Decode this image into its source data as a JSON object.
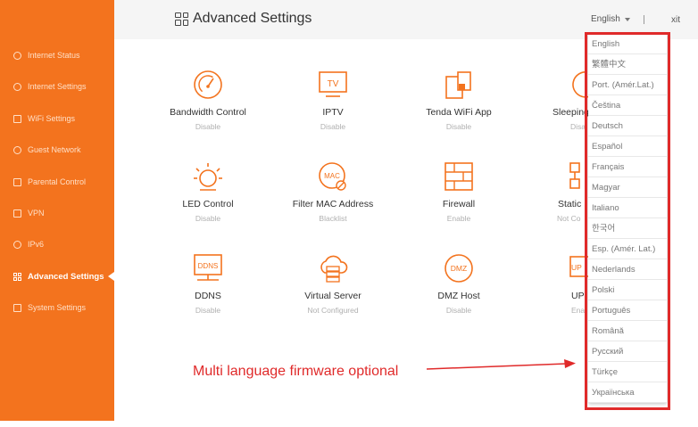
{
  "header": {
    "title": "Advanced Settings",
    "language": "English",
    "exit": "xit"
  },
  "sidebar": {
    "items": [
      {
        "label": "Internet Status",
        "icon": "globe-icon"
      },
      {
        "label": "Internet Settings",
        "icon": "internet-icon"
      },
      {
        "label": "WiFi Settings",
        "icon": "wifi-icon"
      },
      {
        "label": "Guest Network",
        "icon": "guest-icon"
      },
      {
        "label": "Parental Control",
        "icon": "parental-icon"
      },
      {
        "label": "VPN",
        "icon": "vpn-icon"
      },
      {
        "label": "IPv6",
        "icon": "ipv6-icon"
      },
      {
        "label": "Advanced Settings",
        "icon": "grid-icon",
        "active": true
      },
      {
        "label": "System Settings",
        "icon": "system-icon"
      }
    ]
  },
  "features": [
    {
      "label": "Bandwidth Control",
      "status": "Disable",
      "icon": "speedometer-icon"
    },
    {
      "label": "IPTV",
      "status": "Disable",
      "icon": "tv-icon"
    },
    {
      "label": "Tenda WiFi App",
      "status": "Disable",
      "icon": "phone-app-icon"
    },
    {
      "label": "Sleeping",
      "status": "Disa",
      "icon": "sleep-icon"
    },
    {
      "label": "LED Control",
      "status": "Disable",
      "icon": "bulb-icon"
    },
    {
      "label": "Filter MAC Address",
      "status": "Blacklist",
      "icon": "mac-filter-icon"
    },
    {
      "label": "Firewall",
      "status": "Enable",
      "icon": "firewall-icon"
    },
    {
      "label": "Static",
      "status": "Not Co",
      "icon": "static-icon"
    },
    {
      "label": "DDNS",
      "status": "Disable",
      "icon": "ddns-icon"
    },
    {
      "label": "Virtual Server",
      "status": "Not Configured",
      "icon": "server-icon"
    },
    {
      "label": "DMZ Host",
      "status": "Disable",
      "icon": "dmz-icon"
    },
    {
      "label": "UP",
      "status": "Ena",
      "icon": "upnp-icon"
    }
  ],
  "language_menu": {
    "options": [
      "English",
      "繁體中文",
      "Port. (Amér.Lat.)",
      "Čeština",
      "Deutsch",
      "Español",
      "Français",
      "Magyar",
      "Italiano",
      "한국어",
      "Esp. (Amér. Lat.)",
      "Nederlands",
      "Polski",
      "Português",
      "Română",
      "Русский",
      "Türkçe",
      "Українська"
    ]
  },
  "annotation": {
    "text": "Multi language firmware optional"
  },
  "colors": {
    "accent": "#f3731e",
    "annotation": "#e02a2a"
  }
}
